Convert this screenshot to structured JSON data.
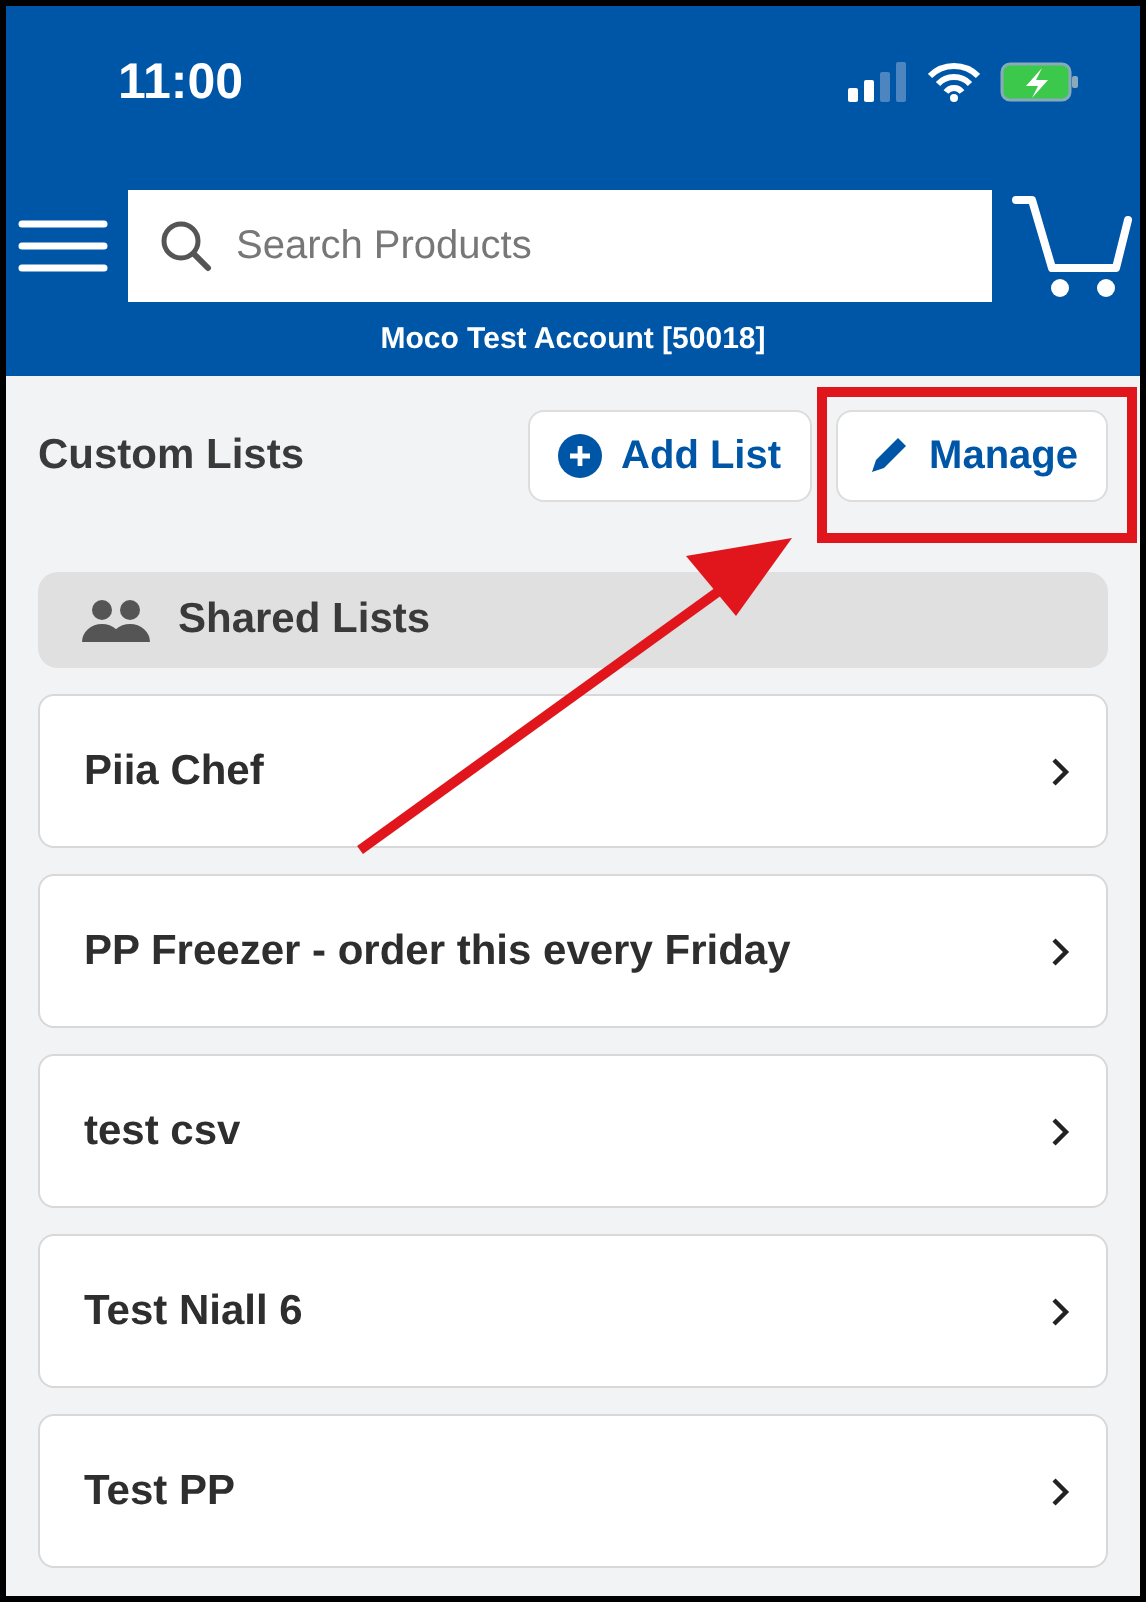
{
  "status_bar": {
    "time": "11:00"
  },
  "search": {
    "placeholder": "Search Products"
  },
  "account": "Moco Test Account [50018]",
  "section": {
    "title": "Custom Lists",
    "buttons": [
      {
        "kind": "add",
        "label": "Add List"
      },
      {
        "kind": "edit",
        "label": "Manage"
      }
    ]
  },
  "shared_tab": {
    "label": "Shared Lists"
  },
  "lists": [
    {
      "name": "Piia Chef"
    },
    {
      "name": "PP Freezer - order this every Friday"
    },
    {
      "name": "test csv"
    },
    {
      "name": "Test Niall 6"
    },
    {
      "name": "Test PP"
    }
  ]
}
